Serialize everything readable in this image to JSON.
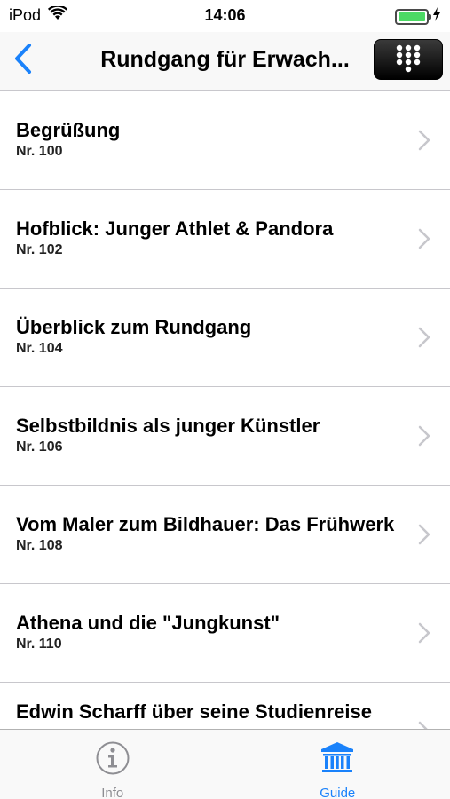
{
  "status_bar": {
    "carrier": "iPod",
    "time": "14:06",
    "battery_level": 1.0,
    "icons": [
      "wifi-icon",
      "battery-icon",
      "charging-icon"
    ]
  },
  "nav": {
    "title": "Rundgang für Erwach...",
    "back_icon": "chevron-left-icon",
    "keypad_icon": "keypad-grid-icon"
  },
  "list": {
    "items": [
      {
        "title": "Begrüßung",
        "number": "Nr. 100"
      },
      {
        "title": "Hofblick: Junger Athlet & Pandora",
        "number": "Nr. 102"
      },
      {
        "title": "Überblick zum Rundgang",
        "number": "Nr. 104"
      },
      {
        "title": "Selbstbildnis als junger Künstler",
        "number": "Nr. 106"
      },
      {
        "title": "Vom Maler zum Bildhauer: Das Frühwerk",
        "number": "Nr. 108"
      },
      {
        "title": "Athena und die \"Jungkunst\"",
        "number": "Nr. 110"
      },
      {
        "title": "Edwin Scharff über seine Studienreise",
        "number": ""
      }
    ]
  },
  "tab_bar": {
    "tabs": [
      {
        "label": "Info",
        "icon": "info-icon",
        "active": false
      },
      {
        "label": "Guide",
        "icon": "museum-icon",
        "active": true
      }
    ]
  },
  "colors": {
    "accent": "#1a82fb",
    "inactive": "#8e8e93",
    "separator": "#c8c7cc",
    "battery": "#4cd964"
  }
}
